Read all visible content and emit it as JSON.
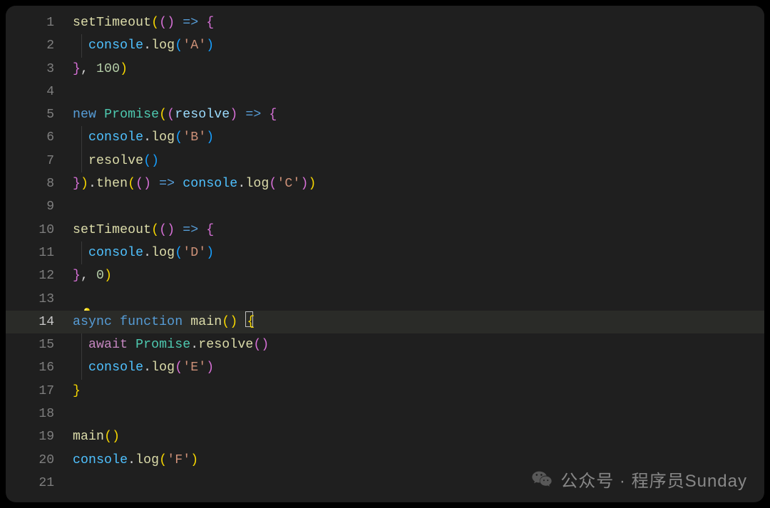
{
  "watermark": {
    "prefix": "公众号 · ",
    "name": "程序员Sunday",
    "icon": "wechat-icon"
  },
  "editor": {
    "highlighted_line": 14,
    "lightbulb_line": 13,
    "lines": [
      {
        "n": 1,
        "tokens": [
          [
            "fn",
            "setTimeout"
          ],
          [
            "br-y",
            "("
          ],
          [
            "br-p",
            "("
          ],
          [
            "br-p",
            ")"
          ],
          [
            "pun",
            " "
          ],
          [
            "kw",
            "=>"
          ],
          [
            "pun",
            " "
          ],
          [
            "br-p",
            "{"
          ]
        ]
      },
      {
        "n": 2,
        "indent": 1,
        "tokens": [
          [
            "obj",
            "console"
          ],
          [
            "pun",
            "."
          ],
          [
            "fn",
            "log"
          ],
          [
            "br-b",
            "("
          ],
          [
            "str",
            "'A'"
          ],
          [
            "br-b",
            ")"
          ]
        ]
      },
      {
        "n": 3,
        "tokens": [
          [
            "br-p",
            "}"
          ],
          [
            "pun",
            ", "
          ],
          [
            "num",
            "100"
          ],
          [
            "br-y",
            ")"
          ]
        ]
      },
      {
        "n": 4,
        "tokens": []
      },
      {
        "n": 5,
        "tokens": [
          [
            "kw",
            "new"
          ],
          [
            "pun",
            " "
          ],
          [
            "cls",
            "Promise"
          ],
          [
            "br-y",
            "("
          ],
          [
            "br-p",
            "("
          ],
          [
            "var",
            "resolve"
          ],
          [
            "br-p",
            ")"
          ],
          [
            "pun",
            " "
          ],
          [
            "kw",
            "=>"
          ],
          [
            "pun",
            " "
          ],
          [
            "br-p",
            "{"
          ]
        ]
      },
      {
        "n": 6,
        "indent": 1,
        "tokens": [
          [
            "obj",
            "console"
          ],
          [
            "pun",
            "."
          ],
          [
            "fn",
            "log"
          ],
          [
            "br-b",
            "("
          ],
          [
            "str",
            "'B'"
          ],
          [
            "br-b",
            ")"
          ]
        ]
      },
      {
        "n": 7,
        "indent": 1,
        "tokens": [
          [
            "fn",
            "resolve"
          ],
          [
            "br-b",
            "("
          ],
          [
            "br-b",
            ")"
          ]
        ]
      },
      {
        "n": 8,
        "tokens": [
          [
            "br-p",
            "}"
          ],
          [
            "br-y",
            ")"
          ],
          [
            "pun",
            "."
          ],
          [
            "fn",
            "then"
          ],
          [
            "br-y",
            "("
          ],
          [
            "br-p",
            "("
          ],
          [
            "br-p",
            ")"
          ],
          [
            "pun",
            " "
          ],
          [
            "kw",
            "=>"
          ],
          [
            "pun",
            " "
          ],
          [
            "obj",
            "console"
          ],
          [
            "pun",
            "."
          ],
          [
            "fn",
            "log"
          ],
          [
            "br-p",
            "("
          ],
          [
            "str",
            "'C'"
          ],
          [
            "br-p",
            ")"
          ],
          [
            "br-y",
            ")"
          ]
        ]
      },
      {
        "n": 9,
        "tokens": []
      },
      {
        "n": 10,
        "tokens": [
          [
            "fn",
            "setTimeout"
          ],
          [
            "br-y",
            "("
          ],
          [
            "br-p",
            "("
          ],
          [
            "br-p",
            ")"
          ],
          [
            "pun",
            " "
          ],
          [
            "kw",
            "=>"
          ],
          [
            "pun",
            " "
          ],
          [
            "br-p",
            "{"
          ]
        ]
      },
      {
        "n": 11,
        "indent": 1,
        "tokens": [
          [
            "obj",
            "console"
          ],
          [
            "pun",
            "."
          ],
          [
            "fn",
            "log"
          ],
          [
            "br-b",
            "("
          ],
          [
            "str",
            "'D'"
          ],
          [
            "br-b",
            ")"
          ]
        ]
      },
      {
        "n": 12,
        "tokens": [
          [
            "br-p",
            "}"
          ],
          [
            "pun",
            ", "
          ],
          [
            "num",
            "0"
          ],
          [
            "br-y",
            ")"
          ]
        ]
      },
      {
        "n": 13,
        "tokens": []
      },
      {
        "n": 14,
        "tokens": [
          [
            "kw",
            "async"
          ],
          [
            "pun",
            " "
          ],
          [
            "kw",
            "function"
          ],
          [
            "pun",
            " "
          ],
          [
            "fn",
            "main"
          ],
          [
            "br-y",
            "("
          ],
          [
            "br-y",
            ")"
          ],
          [
            "pun",
            " "
          ],
          [
            "cursor",
            "{"
          ]
        ]
      },
      {
        "n": 15,
        "indent": 1,
        "tokens": [
          [
            "kw2",
            "await"
          ],
          [
            "pun",
            " "
          ],
          [
            "cls",
            "Promise"
          ],
          [
            "pun",
            "."
          ],
          [
            "fn",
            "resolve"
          ],
          [
            "br-p",
            "("
          ],
          [
            "br-p",
            ")"
          ]
        ]
      },
      {
        "n": 16,
        "indent": 1,
        "tokens": [
          [
            "obj",
            "console"
          ],
          [
            "pun",
            "."
          ],
          [
            "fn",
            "log"
          ],
          [
            "br-p",
            "("
          ],
          [
            "str",
            "'E'"
          ],
          [
            "br-p",
            ")"
          ]
        ]
      },
      {
        "n": 17,
        "tokens": [
          [
            "br-y",
            "}"
          ]
        ]
      },
      {
        "n": 18,
        "tokens": []
      },
      {
        "n": 19,
        "tokens": [
          [
            "fn",
            "main"
          ],
          [
            "br-y",
            "("
          ],
          [
            "br-y",
            ")"
          ]
        ]
      },
      {
        "n": 20,
        "tokens": [
          [
            "obj",
            "console"
          ],
          [
            "pun",
            "."
          ],
          [
            "fn",
            "log"
          ],
          [
            "br-y",
            "("
          ],
          [
            "str",
            "'F'"
          ],
          [
            "br-y",
            ")"
          ]
        ]
      },
      {
        "n": 21,
        "tokens": []
      }
    ]
  }
}
